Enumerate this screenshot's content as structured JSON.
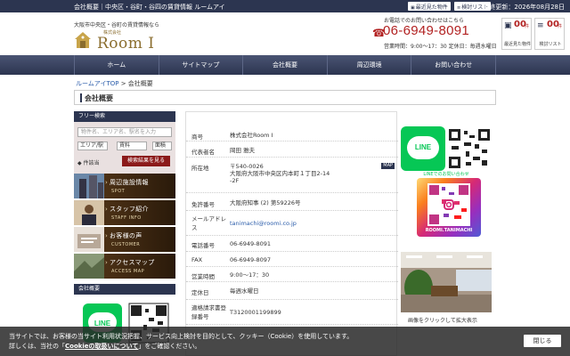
{
  "topbar": {
    "breadcrumb_text": "会社概要｜中央区・谷町・谷四の賃貸情報 ルームアイ",
    "recent_btn": "最近見た物件",
    "review_btn": "検討リスト",
    "updated_text": "最終更新：2026年08月28日"
  },
  "header": {
    "tagline": "大阪市中央区・谷町の賃貸情報なら",
    "logo_sub": "株式会社",
    "logo_main": "Room I",
    "contact_label": "お電話でのお問い合わせはこちら",
    "phone": "06-6949-8091",
    "hours": "営業時間：9:00～17：30 定休日：毎週水曜日",
    "recent_count": "00",
    "recent_unit": "件",
    "recent_label": "最近見た物件",
    "review_count": "00",
    "review_unit": "件",
    "review_label": "検討リスト"
  },
  "nav": {
    "items": [
      "ホーム",
      "サイトマップ",
      "会社概要",
      "周辺環境",
      "お問い合わせ"
    ]
  },
  "breadcrumb": {
    "home": "ルームアイTOP",
    "sep": ">",
    "current": "会社概要"
  },
  "page_title": "会社概要",
  "sidebar": {
    "free_search_title": "フリー検索",
    "input_placeholder": "物件名、エリア名、駅名を入力",
    "sel1": "エリア/駅",
    "sel2": "賃料",
    "sel3": "面積",
    "cond_label": "◆ 件該当",
    "search_button": "検索結果を見る",
    "banners": [
      {
        "title": "周辺施設情報",
        "sub": "SPOT"
      },
      {
        "title": "スタッフ紹介",
        "sub": "STAFF INFO"
      },
      {
        "title": "お客様の声",
        "sub": "CUSTOMER"
      },
      {
        "title": "アクセスマップ",
        "sub": "ACCESS MAP"
      }
    ],
    "company_title": "会社概要"
  },
  "company": {
    "rows": [
      {
        "k": "商号",
        "v": "株式会社Room I"
      },
      {
        "k": "代表者名",
        "v": "岡田 雅夫"
      },
      {
        "k": "所在地",
        "v": "〒540-0026\n大阪府大阪市中央区内本町１丁目2-14\n-2F"
      },
      {
        "k": "免許番号",
        "v": "大阪府知事 (2) 第59226号"
      },
      {
        "k": "メールアドレス",
        "v": "tanimachi@roomi.co.jp"
      },
      {
        "k": "電話番号",
        "v": "06-6949-8091"
      },
      {
        "k": "FAX",
        "v": "06-6949-8097"
      },
      {
        "k": "営業時間",
        "v": "9:00～17：30"
      },
      {
        "k": "定休日",
        "v": "毎週水曜日"
      },
      {
        "k": "適格請求書登録番号",
        "v": "T3120001199899"
      }
    ],
    "map_badge": "MAP"
  },
  "right": {
    "line_label": "LINE",
    "line_caption": "LINEでのお問い合わせ",
    "ig_caption": "ROOMI.TANIMACHI",
    "photo_caption": "画像をクリックして拡大表示"
  },
  "cookie": {
    "line1": "当サイトでは、お客様の当サイト利用状況把握、サービス向上検討を目的として、クッキー（Cookie）を使用しています。",
    "line2a": "詳しくは、当社の「",
    "line2_link": "Cookieの取扱いについて",
    "line2b": "」をご確認ください。",
    "close": "閉じる"
  },
  "colors": {
    "navy": "#2c3550",
    "accent_red": "#b22222",
    "line_green": "#06c755",
    "logo_gold": "#8a6d2e"
  }
}
